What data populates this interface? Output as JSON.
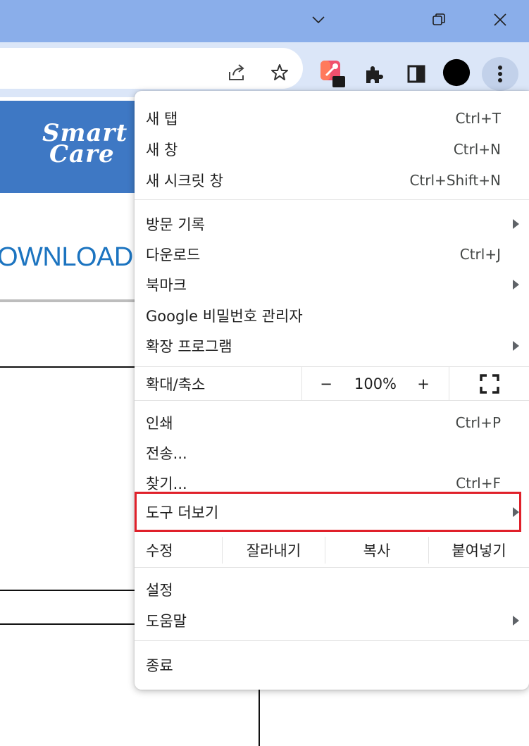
{
  "page": {
    "logo_line1": "Smart",
    "logo_line2": "Care",
    "download_label": "OWNLOAD"
  },
  "window_controls": {
    "dropdown": "⌵",
    "restore": "❐",
    "close": "✕"
  },
  "toolbar": {
    "share_icon": "share-icon",
    "star_icon": "star-icon",
    "extension_icon": "eyedropper-extension-icon",
    "puzzle_icon": "puzzle-icon",
    "sidepanel_icon": "side-panel-icon",
    "profile_icon": "profile-avatar",
    "menu_icon": "kebab-menu-icon"
  },
  "menu": {
    "new_tab": {
      "label": "새 탭",
      "shortcut": "Ctrl+T"
    },
    "new_window": {
      "label": "새 창",
      "shortcut": "Ctrl+N"
    },
    "incognito": {
      "label": "새 시크릿 창",
      "shortcut": "Ctrl+Shift+N"
    },
    "history": {
      "label": "방문 기록"
    },
    "downloads": {
      "label": "다운로드",
      "shortcut": "Ctrl+J"
    },
    "bookmarks": {
      "label": "북마크"
    },
    "passwords": {
      "label": "Google 비밀번호 관리자"
    },
    "extensions": {
      "label": "확장 프로그램"
    },
    "zoom": {
      "label": "확대/축소",
      "minus": "−",
      "value": "100%",
      "plus": "+"
    },
    "print": {
      "label": "인쇄",
      "shortcut": "Ctrl+P"
    },
    "cast": {
      "label": "전송..."
    },
    "find": {
      "label": "찾기...",
      "shortcut": "Ctrl+F"
    },
    "more_tools": {
      "label": "도구 더보기"
    },
    "edit": {
      "label": "수정",
      "cut": "잘라내기",
      "copy": "복사",
      "paste": "붙여넣기"
    },
    "settings": {
      "label": "설정"
    },
    "help": {
      "label": "도움말"
    },
    "exit": {
      "label": "종료"
    }
  },
  "colors": {
    "titlebar": "#8aaeea",
    "toolbar": "#dbe6f8",
    "banner": "#3e78c4",
    "highlight": "#e0202a"
  }
}
